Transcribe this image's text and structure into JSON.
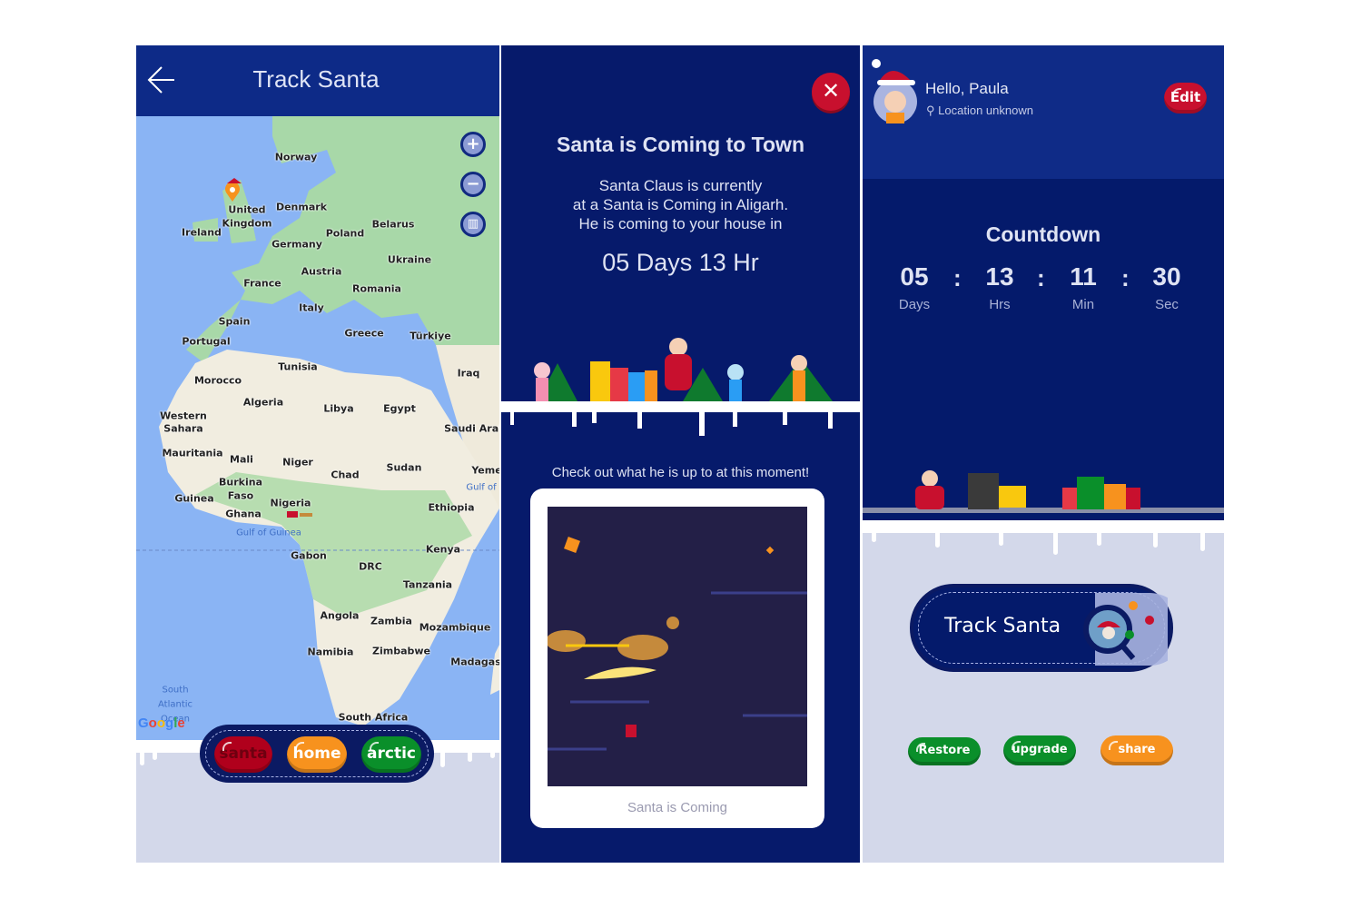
{
  "track_screen": {
    "title": "Track Santa",
    "back_icon": "arrow-left-icon",
    "map_labels": [
      "Norway",
      "United",
      "Kingdom",
      "Ireland",
      "Denmark",
      "Belarus",
      "Poland",
      "Germany",
      "Ukraine",
      "Austria",
      "France",
      "Romania",
      "Italy",
      "Spain",
      "Portugal",
      "Greece",
      "Türkiye",
      "Tunisia",
      "Morocco",
      "Iraq",
      "Algeria",
      "Libya",
      "Egypt",
      "Western",
      "Sahara",
      "Saudi Aral",
      "Mauritania",
      "Mali",
      "Niger",
      "Chad",
      "Sudan",
      "Yeme",
      "Burkina",
      "Faso",
      "Guinea",
      "Nigeria",
      "Ghana",
      "Ethiopia",
      "Kenya",
      "Gabon",
      "DRC",
      "Tanzania",
      "Angola",
      "Zambia",
      "Mozambique",
      "Namibia",
      "Zimbabwe",
      "Madagas",
      "South Africa"
    ],
    "sea_labels": [
      "Gulf of Guinea",
      "Gulf of",
      "South",
      "Atlantic",
      "Ocean"
    ],
    "google_logo": "Google",
    "zoom_in": "+",
    "zoom_out": "−",
    "nav": {
      "santa": "santa",
      "home": "home",
      "arctic": "arctic"
    },
    "colors": {
      "santa": "#b0001c",
      "home": "#f7921e",
      "arctic": "#0a8f2a"
    }
  },
  "popup": {
    "close": "✕",
    "title": "Santa is Coming to Town",
    "line1": "Santa Claus is currently",
    "line2": "at a Santa is Coming in Aligarh.",
    "line3": "He is coming to your house in",
    "eta": "05 Days 13 Hr",
    "check_out": "Check out what he is up to at this moment!",
    "caption": "Santa is Coming"
  },
  "home_screen": {
    "greeting": "Hello, Paula",
    "location": "Location unknown",
    "edit": "Edit",
    "countdown_title": "Countdown",
    "countdown": [
      {
        "value": "05",
        "label": "Days"
      },
      {
        "value": "13",
        "label": "Hrs"
      },
      {
        "value": "11",
        "label": "Min"
      },
      {
        "value": "30",
        "label": "Sec"
      }
    ],
    "track_button": "Track Santa",
    "restore": "Restore",
    "upgrade": "upgrade",
    "share": "share"
  }
}
